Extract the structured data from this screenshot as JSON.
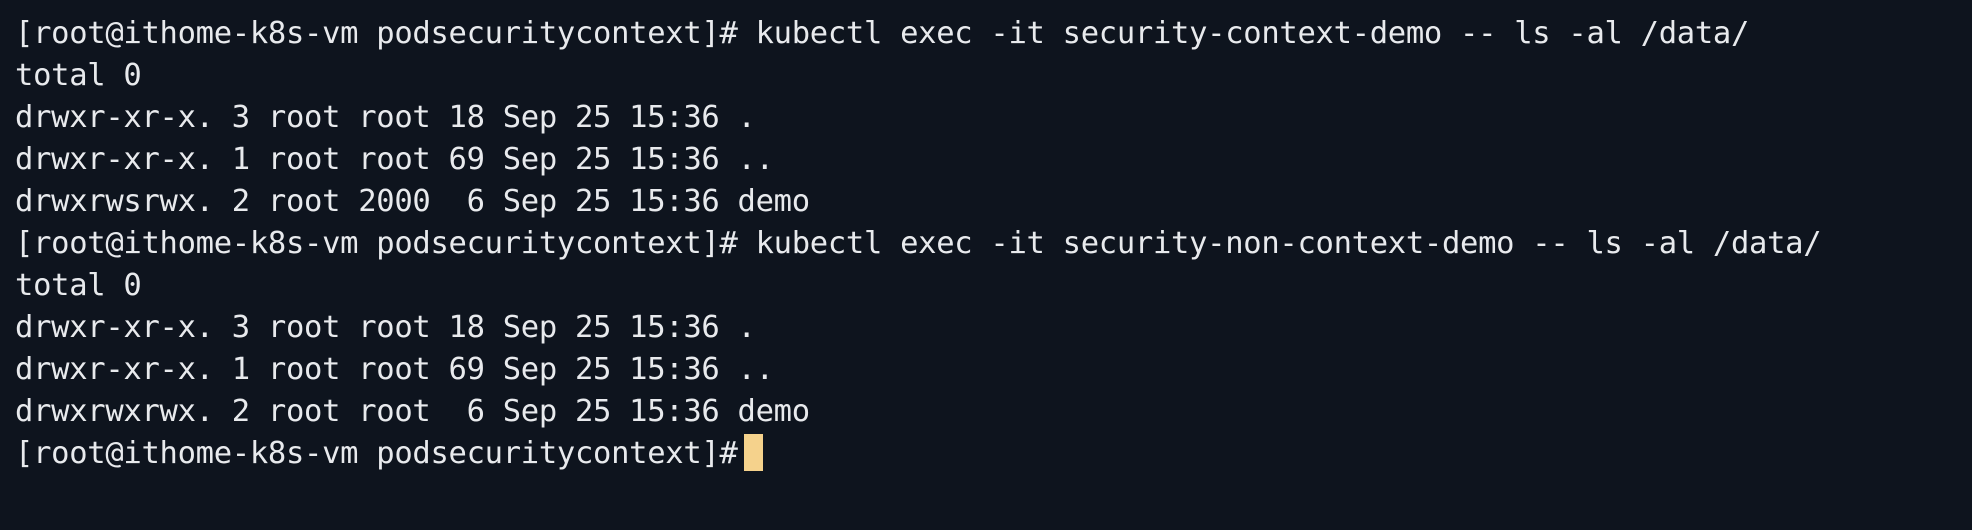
{
  "colors": {
    "background": "#0e141e",
    "foreground": "#e8eaed",
    "cursor": "#f5d28c"
  },
  "terminal": {
    "lines": [
      "[root@ithome-k8s-vm podsecuritycontext]# kubectl exec -it security-context-demo -- ls -al /data/",
      "total 0",
      "drwxr-xr-x. 3 root root 18 Sep 25 15:36 .",
      "drwxr-xr-x. 1 root root 69 Sep 25 15:36 ..",
      "drwxrwsrwx. 2 root 2000  6 Sep 25 15:36 demo",
      "[root@ithome-k8s-vm podsecuritycontext]# kubectl exec -it security-non-context-demo -- ls -al /data/",
      "total 0",
      "drwxr-xr-x. 3 root root 18 Sep 25 15:36 .",
      "drwxr-xr-x. 1 root root 69 Sep 25 15:36 ..",
      "drwxrwxrwx. 2 root root  6 Sep 25 15:36 demo"
    ],
    "prompt": "[root@ithome-k8s-vm podsecuritycontext]#"
  }
}
